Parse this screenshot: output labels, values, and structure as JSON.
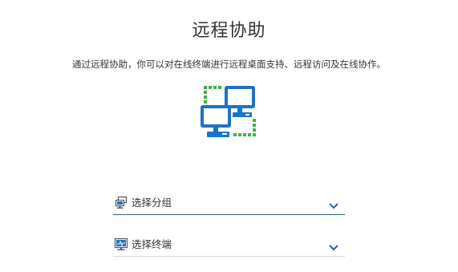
{
  "page": {
    "title": "远程协助",
    "description": "通过远程协助，你可以对在线终端进行远程桌面支持、远程访问及在线协作。"
  },
  "hero": {
    "icon": "networked-computers-icon"
  },
  "fields": {
    "group": {
      "label": "选择分组",
      "icon": "computer-group-icon",
      "dropdown_icon": "chevron-down-icon"
    },
    "terminal": {
      "label": "选择终端",
      "icon": "monitor-terminal-icon",
      "dropdown_icon": "chevron-down-icon"
    }
  },
  "colors": {
    "accent_blue": "#1a73c8",
    "dotted_green": "#3bb34a",
    "active_underline": "#2f5fa8",
    "text": "#333333"
  }
}
